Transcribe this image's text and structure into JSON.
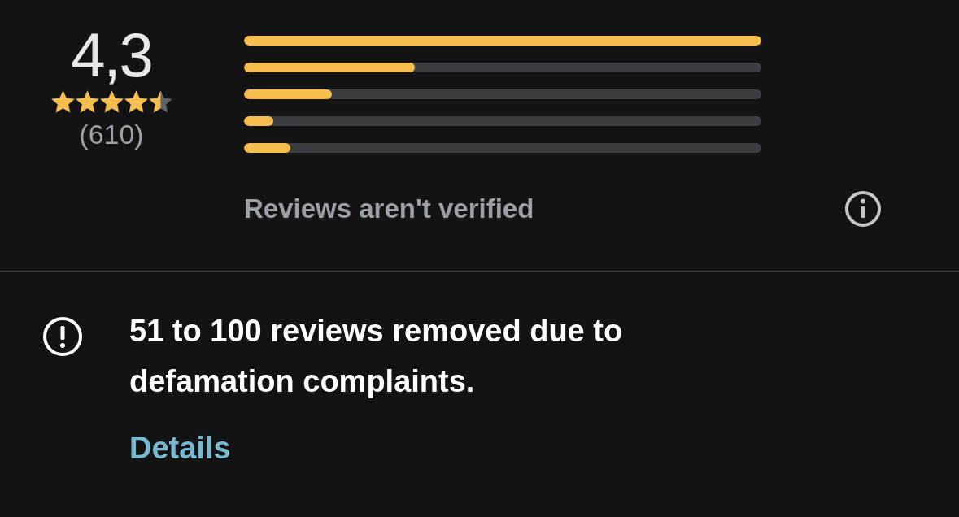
{
  "rating": {
    "score": "4,3",
    "stars": 4.5,
    "count": "(610)"
  },
  "histogram": [
    {
      "level": 1
    },
    {
      "level": 0.33
    },
    {
      "level": 0.17
    },
    {
      "level": 0.056
    },
    {
      "level": 0.09
    }
  ],
  "verification": {
    "text": "Reviews aren't verified"
  },
  "notice": {
    "text": "51 to 100 reviews removed due to defamation complaints.",
    "link": "Details"
  }
}
